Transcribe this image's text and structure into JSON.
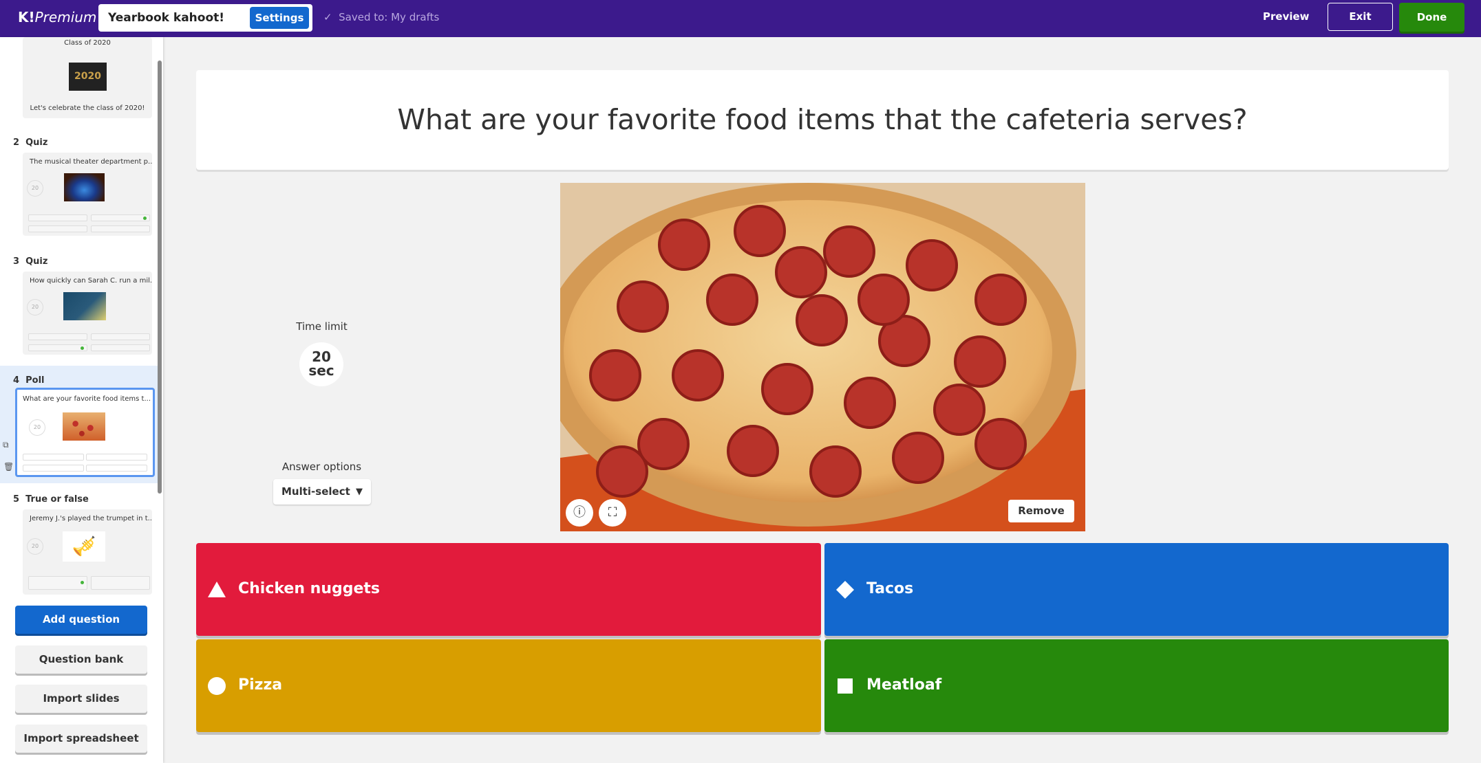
{
  "header": {
    "logo": "K!",
    "logo_suffix": "Premium",
    "kahoot_title": "Yearbook kahoot!",
    "settings_label": "Settings",
    "saved_status": "Saved to: My drafts",
    "preview_label": "Preview",
    "exit_label": "Exit",
    "done_label": "Done"
  },
  "sidebar": {
    "title_card": {
      "title": "Class of 2020",
      "image_text": "2020",
      "description": "Let's celebrate the class of 2020!"
    },
    "questions": [
      {
        "number": "2",
        "type": "Quiz",
        "text": "The musical theater department p...",
        "time": "20"
      },
      {
        "number": "3",
        "type": "Quiz",
        "text": "How quickly can Sarah C. run a mil...",
        "time": "20"
      },
      {
        "number": "4",
        "type": "Poll",
        "text": "What are your favorite food items t...",
        "time": "20"
      },
      {
        "number": "5",
        "type": "True or false",
        "text": "Jeremy J.'s played the trumpet in t...",
        "time": "20"
      }
    ],
    "buttons": {
      "add_question": "Add question",
      "question_bank": "Question bank",
      "import_slides": "Import slides",
      "import_spreadsheet": "Import spreadsheet"
    }
  },
  "editor": {
    "question": "What are your favorite food items that the cafeteria serves?",
    "time_limit_label": "Time limit",
    "time_limit_value": "20",
    "time_limit_unit": "sec",
    "answer_options_label": "Answer options",
    "answer_options_value": "Multi-select",
    "remove_label": "Remove",
    "answers": [
      {
        "text": "Chicken nuggets",
        "shape": "triangle",
        "color": "#e21b3c"
      },
      {
        "text": "Tacos",
        "shape": "diamond",
        "color": "#1368ce"
      },
      {
        "text": "Pizza",
        "shape": "circle",
        "color": "#d89e00"
      },
      {
        "text": "Meatloaf",
        "shape": "square",
        "color": "#26890c"
      }
    ]
  }
}
